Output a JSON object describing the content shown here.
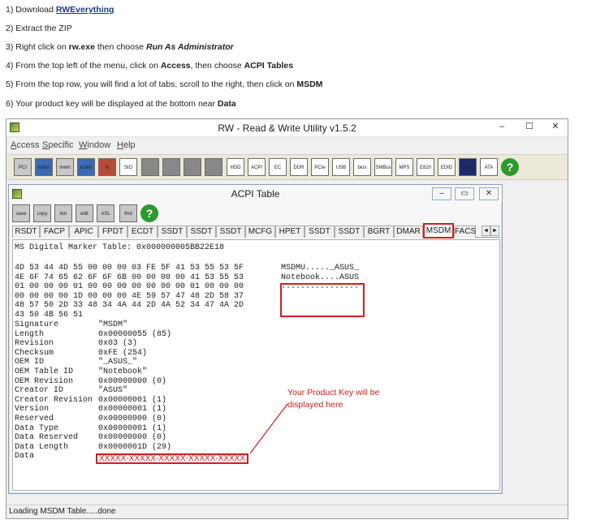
{
  "instructions": {
    "step1_prefix": "1) Download ",
    "step1_link": "RWEverything",
    "step2": "2) Extract the ZIP",
    "step3_prefix": "3) Right click on ",
    "step3_file": "rw.exe",
    "step3_mid": " then choose ",
    "step3_action": "Run As Administrator",
    "step4_prefix": "4) From the top left of the menu, click on ",
    "step4_menu": "Access",
    "step4_mid": ", then choose ",
    "step4_item": "ACPI Tables",
    "step5_prefix": "5) From the top row, you will find a lot of tabs, scroll to the right, then click on ",
    "step5_tab": "MSDM",
    "step6_prefix": "6) Your product key will be displayed at the bottom near ",
    "step6_field": "Data"
  },
  "main_window": {
    "title": "RW - Read & Write Utility v1.5.2",
    "minimize": "–",
    "maximize": "☐",
    "close": "✕",
    "menu": {
      "access_u": "A",
      "access_rest": "ccess",
      "specific_u": "S",
      "specific_rest": "pecific",
      "window_u": "W",
      "window_rest": "indow",
      "help_u": "H",
      "help_rest": "elp"
    },
    "toolbar": [
      "PCI",
      "index",
      "mem",
      "index",
      "io",
      "SIO",
      "",
      "",
      "",
      "",
      "HDD",
      "ACPI",
      "EC",
      "DDR",
      "PCIe",
      "USB",
      "bios",
      "SMBus",
      "MPS",
      "E820",
      "EDID",
      "cmd",
      "ATA",
      "?"
    ]
  },
  "acpi_window": {
    "title": "ACPI Table",
    "minimize": "–",
    "maximize": "▭",
    "close": "✕",
    "toolbar": [
      "save",
      "copy",
      "bin",
      "edit",
      "ASL",
      "find",
      "?"
    ],
    "tabs": [
      "RSDT",
      "FACP",
      "APIC",
      "FPDT",
      "ECDT",
      "SSDT",
      "SSDT",
      "SSDT",
      "MCFG",
      "HPET",
      "SSDT",
      "SSDT",
      "BGRT",
      "DMAR",
      "MSDM",
      "FACS"
    ],
    "active_tab": "MSDM",
    "scroll_left": "◄",
    "scroll_right": "►",
    "header_line": "MS Digital Marker Table: 0x000000005BB22E18",
    "hex_rows": [
      "4D 53 44 4D 55 00 00 00 03 FE 5F 41 53 55 53 5F",
      "4E 6F 74 65 62 6F 6F 6B 00 00 00 00 41 53 55 53",
      "01 00 00 00 01 00 00 00 00 00 00 00 01 00 00 00",
      "00 00 00 00 1D 00 00 00 4E 59 57 47 48 2D 58 37",
      "48 57 50 2D 33 48 34 4A 44 2D 4A 52 34 47 4A 2D",
      "43 50 4B 56 51"
    ],
    "ascii_rows": [
      "MSDMU....._ASUS_",
      "Notebook....ASUS",
      "................"
    ],
    "fields": [
      {
        "name": "Signature",
        "value": "\"MSDM\""
      },
      {
        "name": "Length",
        "value": "0x00000055 (85)"
      },
      {
        "name": "Revision",
        "value": "0x03 (3)"
      },
      {
        "name": "Checksum",
        "value": "0xFE (254)"
      },
      {
        "name": "OEM ID",
        "value": "\"_ASUS_\""
      },
      {
        "name": "OEM Table ID",
        "value": "\"Notebook\""
      },
      {
        "name": "OEM Revision",
        "value": "0x00000000 (0)"
      },
      {
        "name": "Creator ID",
        "value": "\"ASUS\""
      },
      {
        "name": "Creator Revision",
        "value": "0x00000001 (1)"
      },
      {
        "name": "Version",
        "value": "0x00000001 (1)"
      },
      {
        "name": "Reserved",
        "value": "0x00000000 (0)"
      },
      {
        "name": "Data Type",
        "value": "0x00000001 (1)"
      },
      {
        "name": "Data Reserved",
        "value": "0x00000000 (0)"
      },
      {
        "name": "Data Length",
        "value": "0x0000001D (29)"
      },
      {
        "name": "Data",
        "value": ""
      }
    ],
    "product_key": "XXXXX-XXXXX-XXXXX-XXXXX-XXXXX",
    "annotation": "Your Product Key will be displayed here"
  },
  "status": "Loading MSDM Table.....done",
  "colors": {
    "highlight": "#d21e1e",
    "help_green": "#2e9a2e"
  }
}
